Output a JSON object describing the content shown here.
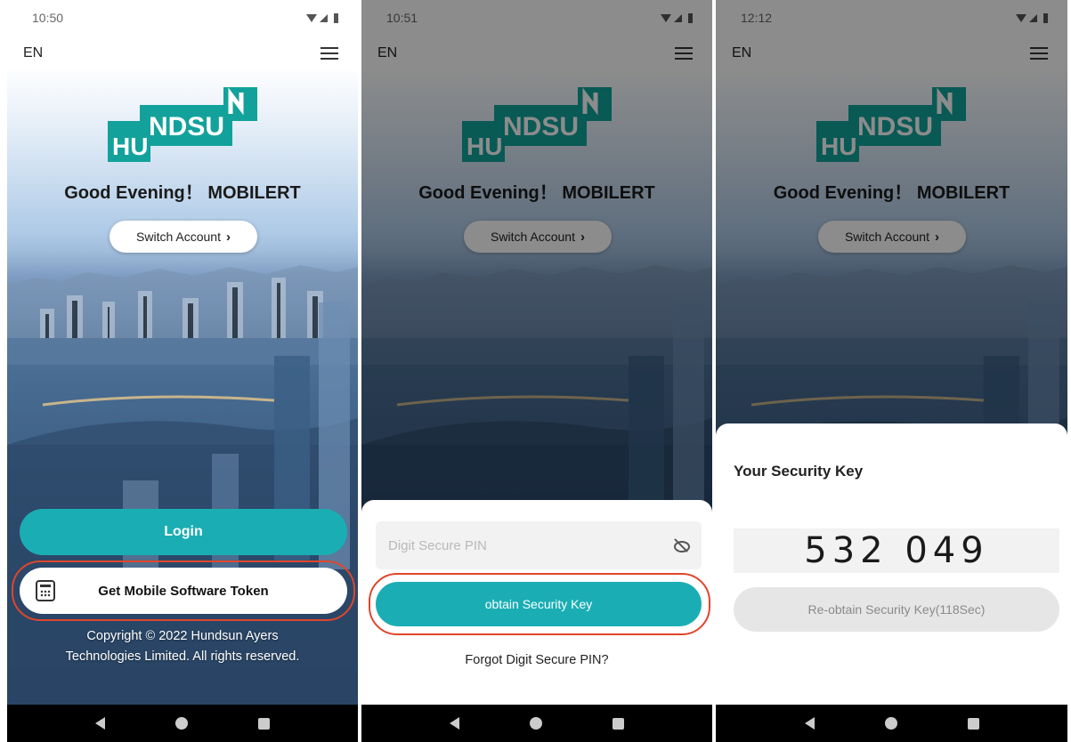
{
  "screens": [
    {
      "time": "10:50",
      "lang": "EN",
      "logo": {
        "text_top": "NDSU",
        "text_bottom": "HU",
        "letter": "N"
      },
      "greeting": "Good Evening！ MOBILERT",
      "switch_account": "Switch Account",
      "login": "Login",
      "token": "Get Mobile Software Token",
      "copyright_line1": "Copyright © 2022 Hundsun Ayers",
      "copyright_line2": "Technologies Limited. All rights reserved."
    },
    {
      "time": "10:51",
      "lang": "EN",
      "greeting": "Good Evening！ MOBILERT",
      "switch_account": "Switch Account",
      "pin_placeholder": "Digit Secure PIN",
      "obtain": "obtain Security Key",
      "forgot": "Forgot Digit Secure PIN?"
    },
    {
      "time": "12:12",
      "lang": "EN",
      "greeting": "Good Evening！ MOBILERT",
      "switch_account": "Switch Account",
      "key_title": "Your Security Key",
      "key_value": "532 049",
      "reobtain": "Re-obtain Security Key(118Sec)"
    }
  ],
  "colors": {
    "accent": "#1aaeb4",
    "highlight": "#e0462b",
    "logo": "#12a29b"
  },
  "icons": {
    "menu": "hamburger-menu-icon",
    "chevron": "chevron-right-icon",
    "calculator": "calculator-icon",
    "eye": "eye-off-icon",
    "nav_back": "back-icon",
    "nav_home": "home-icon",
    "nav_recent": "recent-apps-icon"
  }
}
